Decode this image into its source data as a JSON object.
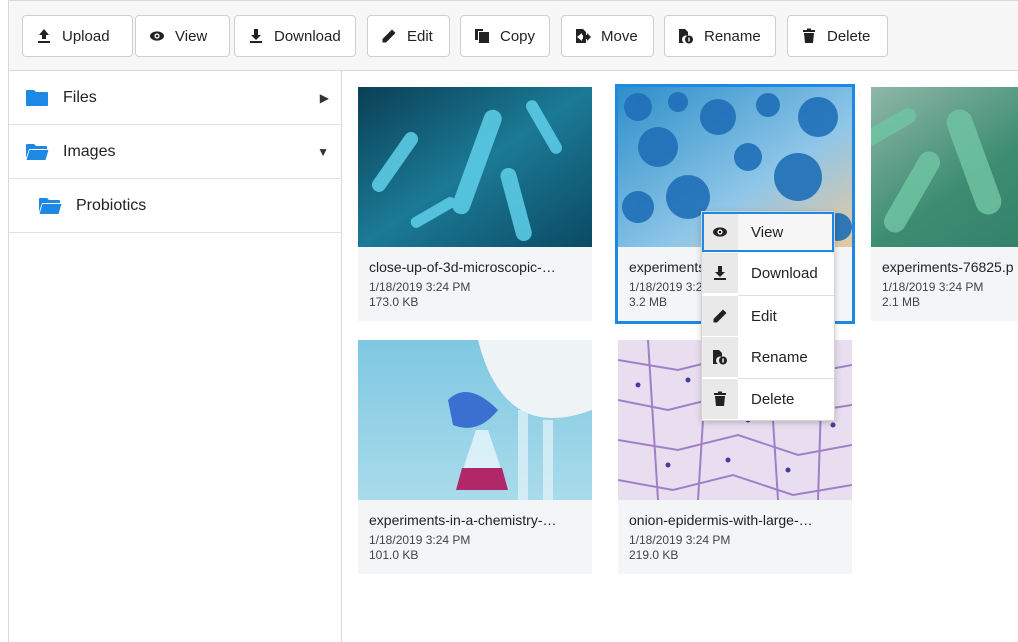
{
  "toolbar": {
    "upload": "Upload",
    "view": "View",
    "download": "Download",
    "edit": "Edit",
    "copy": "Copy",
    "move": "Move",
    "rename": "Rename",
    "delete": "Delete"
  },
  "sidebar": {
    "items": [
      {
        "label": "Files",
        "icon": "folder-icon",
        "arrow": "▶"
      },
      {
        "label": "Images",
        "icon": "folder-open-icon",
        "arrow": "▼"
      },
      {
        "label": "Probiotics",
        "icon": "folder-open-icon"
      }
    ]
  },
  "files": [
    {
      "name": "close-up-of-3d-microscopic-…",
      "date": "1/18/2019 3:24 PM",
      "size": "173.0 KB"
    },
    {
      "name": "experiments",
      "date": "1/18/2019 3:2",
      "size": "3.2 MB"
    },
    {
      "name": "experiments-76825.p",
      "date": "1/18/2019 3:24 PM",
      "size": "2.1 MB"
    },
    {
      "name": "experiments-in-a-chemistry-…",
      "date": "1/18/2019 3:24 PM",
      "size": "101.0 KB"
    },
    {
      "name": "onion-epidermis-with-large-…",
      "date": "1/18/2019 3:24 PM",
      "size": "219.0 KB"
    }
  ],
  "context_menu": {
    "items": [
      "View",
      "Download",
      "Edit",
      "Rename",
      "Delete"
    ]
  },
  "colors": {
    "accent": "#1e88e5",
    "folder": "#1e88e5"
  }
}
